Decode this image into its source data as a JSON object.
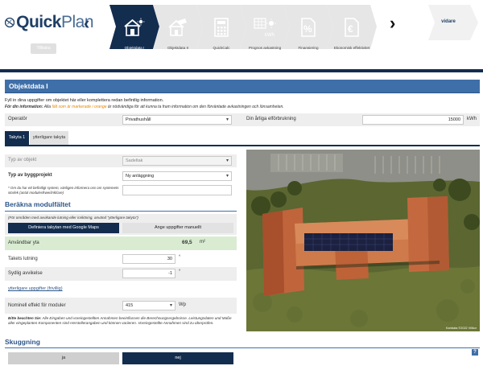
{
  "app": {
    "logo_text_bold": "Quick",
    "logo_text_thin": "Plan",
    "back_button": "Tillbaka",
    "next_button": "vidare"
  },
  "steps": [
    {
      "label": "Objektdata I",
      "icon": "house-solar-icon",
      "active": true
    },
    {
      "label": "Objektdata II",
      "icon": "house-panel-icon",
      "active": false
    },
    {
      "label": "QuickCalc",
      "icon": "calculator-icon",
      "active": false
    },
    {
      "label": "Prognos avkastning",
      "icon": "kwh-sun-icon",
      "active": false
    },
    {
      "label": "Finansiering",
      "icon": "percent-doc-icon",
      "active": false
    },
    {
      "label": "Ekonomisk effektivitet",
      "icon": "euro-doc-icon",
      "active": false
    }
  ],
  "section": {
    "title": "Objektdata I",
    "intro": "Fyll in dina uppgifter om objektet här eller komplettera redan befintlig information.",
    "info_prefix": "För din information:",
    "info_mid": " Alla ",
    "info_orange": "fält som är markerade i orange",
    "info_suffix": " är nödvändiga för att kunna ta fram information om den förväntade avkastningen och lönsamheten."
  },
  "operator": {
    "label": "Operatör",
    "value": "Privathushåll",
    "consumption_label": "Din årliga elförbrukning",
    "consumption_value": "15000",
    "consumption_unit": "kWh"
  },
  "tabs": [
    {
      "label": "Takyta 1",
      "active": true
    },
    {
      "label": "ytterligare takyta",
      "active": false
    }
  ],
  "object": {
    "type_label": "Typ av objekt",
    "type_value": "Sadeltak",
    "project_label": "Typ av byggprojekt",
    "project_value": "Ny anläggning",
    "note": "* Om du har ett befintligt system, vänligen informera oss om systemets storlek (antal moduler/kwei/inkl/are)",
    "note_value": ""
  },
  "module_field": {
    "title": "Beräkna modulfältet",
    "hint": "(För områden med avvikande lutning eller inriktning, använd \"ytterligare takyta\")",
    "btn_maps": "Definiera takytan med Google Maps",
    "btn_manual": "Ange uppgifter manuellt",
    "area_label": "Användbar yta",
    "area_value": "69,5",
    "area_unit": "m²",
    "slope_label": "Takets lutning",
    "slope_value": "30",
    "slope_unit": "°",
    "dev_label": "Sydlig avvikelse",
    "dev_value": "-1",
    "dev_unit": "°",
    "more_link": "ytterligare uppgifter (frivillig)",
    "power_label": "Nominell effekt för moduler",
    "power_value": "415",
    "power_unit": "Wp",
    "note_bold": "Bitte beachten Sie:",
    "note_text": " Alle Eingaben und voreingestellten Annahmen beeinflussen die Berechnungsergebnisse. Leistungsdaten und Maße aller eingeplanten Komponenten sind Herstellerangaben und können variieren. Voreingestellte Annahmen sind zu überprüfen."
  },
  "shading": {
    "title": "Skuggning",
    "yes": "ja",
    "no": "nej",
    "help": "?"
  },
  "map": {
    "footer": "Kartdata ©2022  Villkor"
  },
  "colors": {
    "navy": "#132d4f",
    "accent": "#3f6fa8",
    "green_row": "#d9ecd2",
    "orange": "#e68a00"
  }
}
